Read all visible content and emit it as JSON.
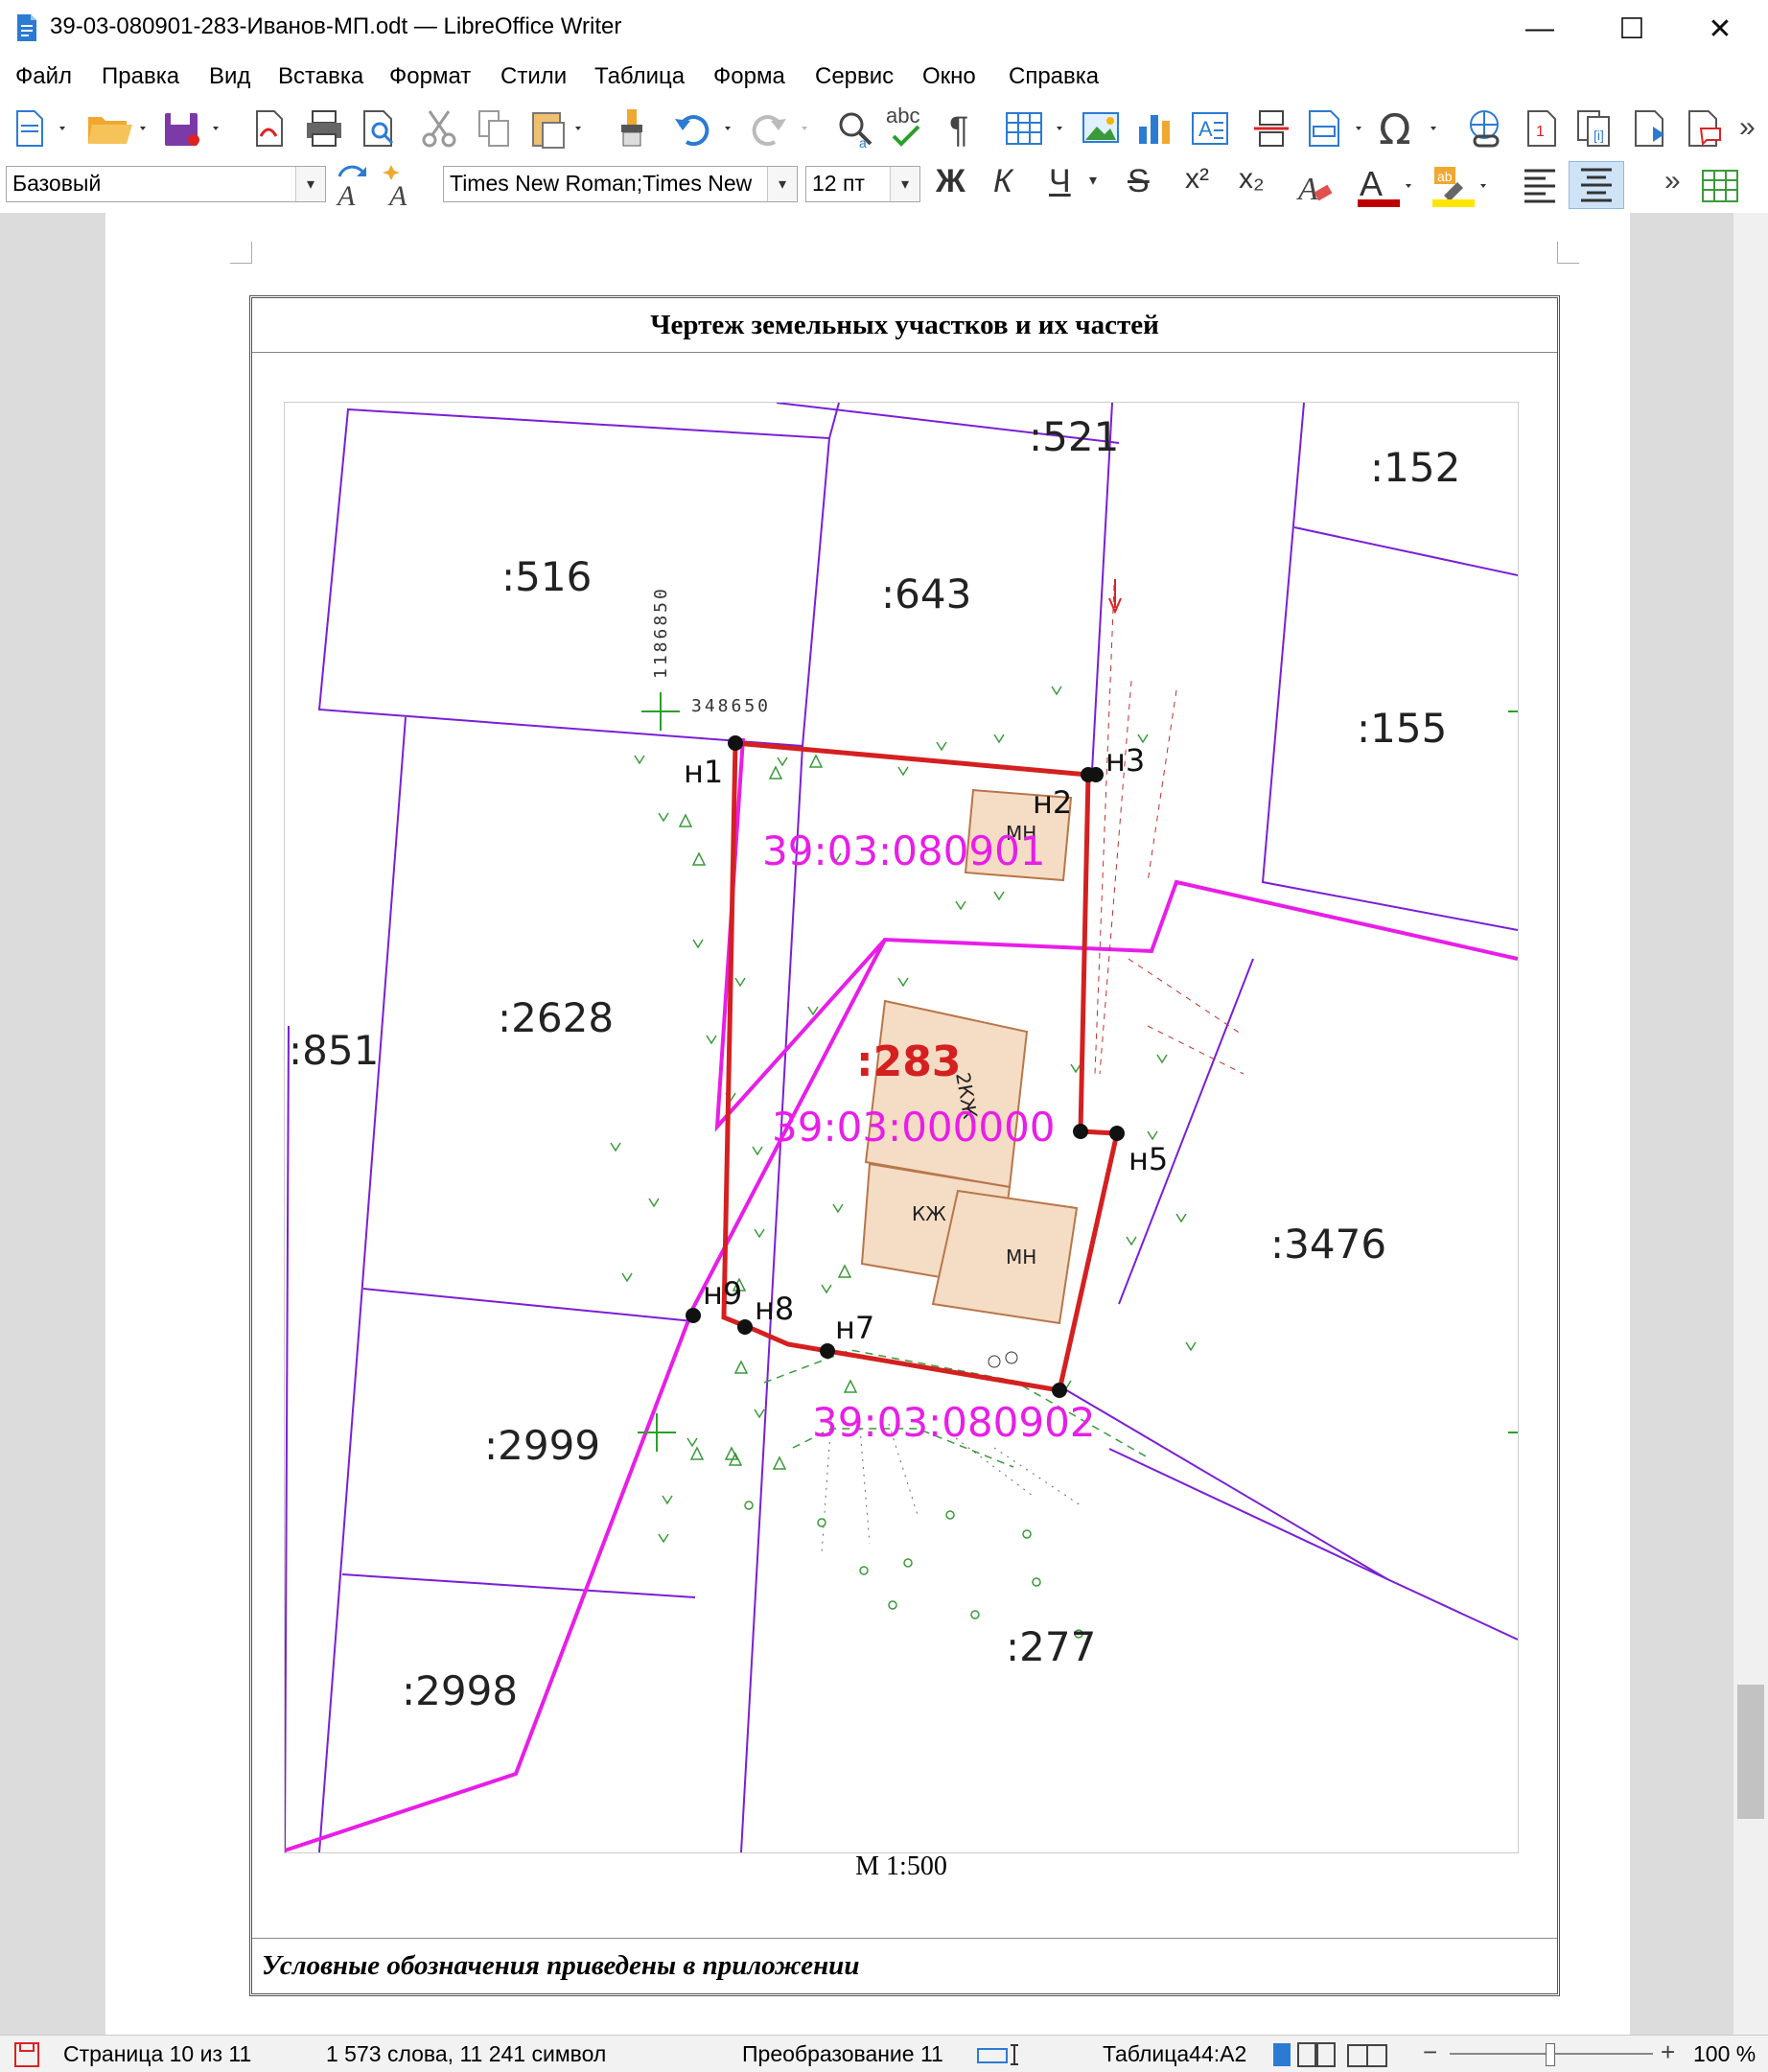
{
  "window": {
    "title": "39-03-080901-283-Иванов-МП.odt — LibreOffice Writer",
    "minimize": "—",
    "maximize": "☐",
    "close": "✕"
  },
  "menu": [
    "Файл",
    "Правка",
    "Вид",
    "Вставка",
    "Формат",
    "Стили",
    "Таблица",
    "Форма",
    "Сервис",
    "Окно",
    "Справка"
  ],
  "formatting": {
    "paragraph_style": "Базовый",
    "font_name": "Times New Roman;Times New",
    "font_size": "12 пт",
    "bold": "Ж",
    "italic": "К",
    "underline": "Ч",
    "strikethrough": "S",
    "superscript": "x²",
    "subscript": "x₂",
    "colors": {
      "font_color": "#c00000",
      "highlight": "#ffe600"
    }
  },
  "document": {
    "table_title": "Чертеж земельных участков и их частей",
    "scale": "М 1:500",
    "legend_note": "Условные обозначения приведены в приложении"
  },
  "map": {
    "parcel_labels": [
      ":521",
      ":152",
      ":516",
      ":643",
      ":155",
      ":2628",
      ":851",
      ":3476",
      ":2999",
      ":277",
      ":2998"
    ],
    "main_parcel": ":283",
    "cadastral_blocks": [
      "39:03:080901",
      "39:03:000000",
      "39:03:080902"
    ],
    "points": [
      "н1",
      "н2",
      "н3",
      "н5",
      "н7",
      "н8",
      "н9"
    ],
    "buildings": [
      "МН",
      "2КЖ",
      "КЖ",
      "МН"
    ],
    "grid_coords": [
      "1186850",
      "348650"
    ],
    "colors": {
      "boundary": "#d42020",
      "parcel_lines": "#7a1fd6",
      "block_lines": "#e81ee8",
      "building_fill": "#f5dcc4"
    }
  },
  "status": {
    "page": "Страница 10 из 11",
    "words": "1 573 слова, 11 241 символ",
    "mode": "Преобразование 11",
    "cell": "Таблица44:A2",
    "zoom": "100 %"
  }
}
